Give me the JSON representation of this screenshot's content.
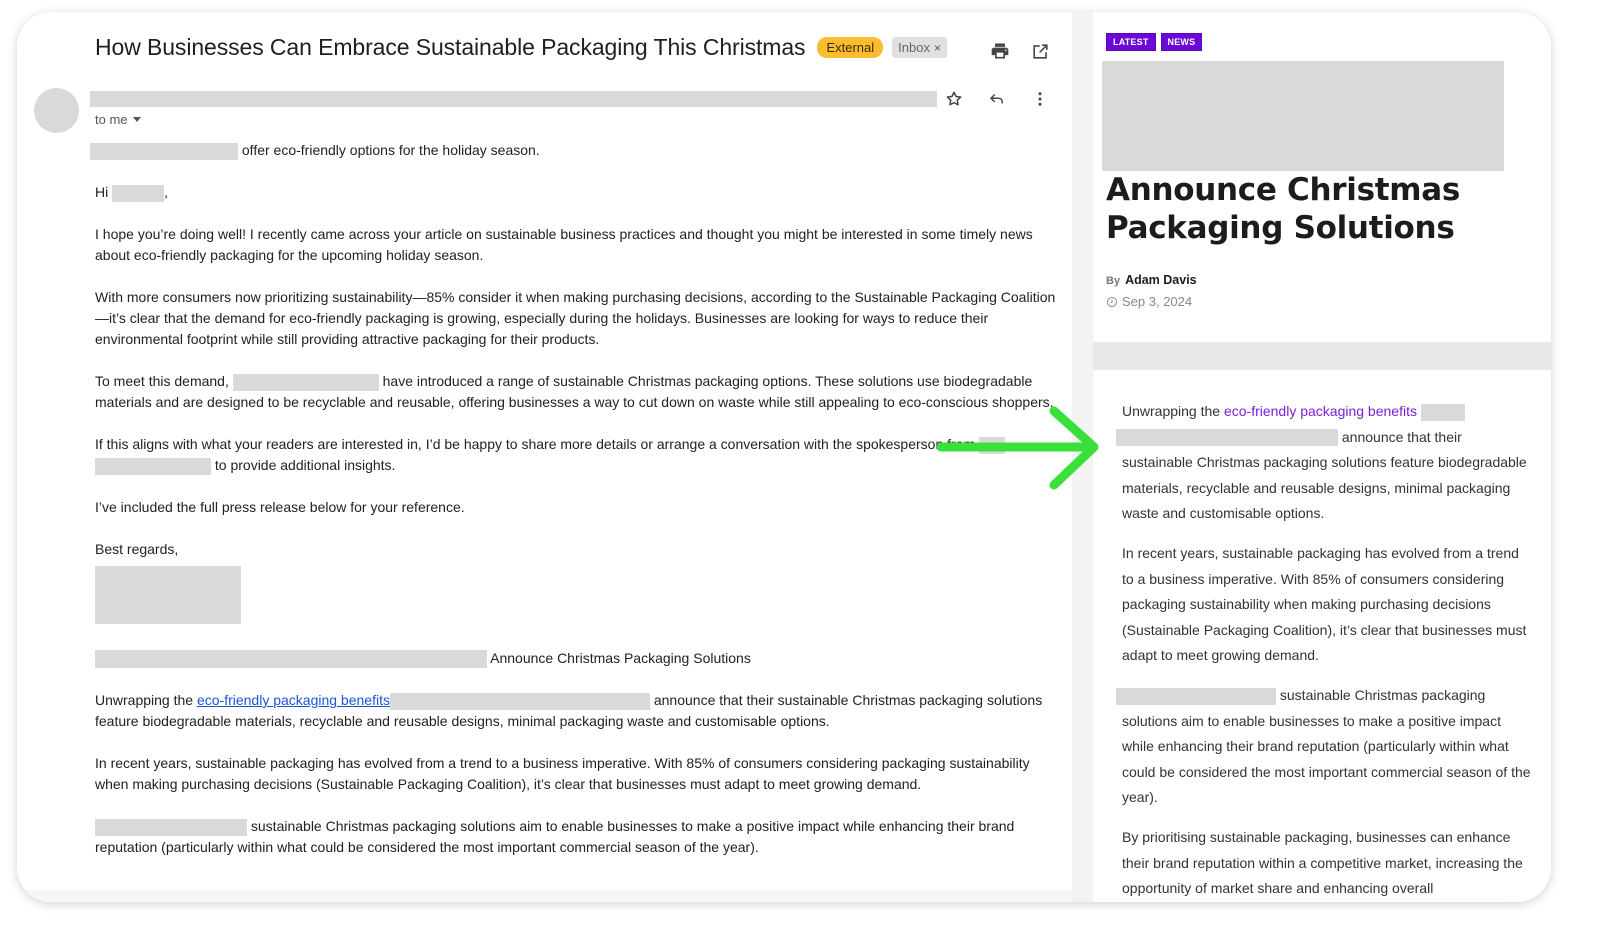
{
  "email": {
    "subject": "How Businesses Can Embrace Sustainable Packaging This Christmas",
    "labels": {
      "external": "External",
      "inbox": "Inbox",
      "inbox_remove": "×"
    },
    "toolbar_icons": [
      "print-icon",
      "open-in-new-window-icon"
    ],
    "message_icons": [
      "star-icon",
      "reply-icon",
      "more-vert-icon"
    ],
    "recipient": "to me",
    "preheader_suffix": "offer eco-friendly options for the holiday season.",
    "greeting_prefix": "Hi",
    "greeting_suffix": ",",
    "paragraphs": {
      "p1": "I hope you’re doing well! I recently came across your article on sustainable business practices and thought you might be interested in some timely news about eco-friendly packaging for the upcoming holiday season.",
      "p2": "With more consumers now prioritizing sustainability—85% consider it when making purchasing decisions, according to the Sustainable Packaging Coalition—it’s clear that the demand for eco-friendly packaging is growing, especially during the holidays. Businesses are looking for ways to reduce their environmental footprint while still providing attractive packaging for their products.",
      "p3_prefix": "To meet this demand,",
      "p3_suffix": "have introduced a range of sustainable Christmas packaging options. These solutions use biodegradable materials and are designed to be recyclable and reusable, offering businesses a way to cut down on waste while still appealing to eco-conscious shoppers.",
      "p4_prefix": "If this aligns with what your readers are interested in, I’d be happy to share more details or arrange a conversation with the spokesperson from",
      "p4_suffix": "to provide additional insights.",
      "p5": "I’ve included the full press release below for your reference.",
      "signoff": "Best regards,"
    },
    "press_release": {
      "headline_suffix": "Announce Christmas Packaging Solutions",
      "pr1_prefix": "Unwrapping the",
      "pr1_link": "eco-friendly packaging benefits",
      "pr1_suffix": "announce that their sustainable Christmas packaging solutions feature biodegradable materials, recyclable and reusable designs, minimal packaging waste and customisable options.",
      "pr2": "In recent years, sustainable packaging has evolved from a trend to a business imperative. With 85% of consumers considering packaging sustainability when making purchasing decisions (Sustainable Packaging Coalition), it’s clear that businesses must adapt to meet growing demand.",
      "pr3_suffix": "sustainable Christmas packaging solutions aim to enable businesses to make a positive impact while enhancing their brand reputation (particularly within what could be considered the most important commercial season of the year)."
    }
  },
  "article": {
    "tags": [
      "LATEST",
      "NEWS"
    ],
    "title": "Announce Christmas Packaging Solutions",
    "byline_prefix": "By",
    "author": "Adam Davis",
    "date": "Sep 3, 2024",
    "body": {
      "a1_prefix": "Unwrapping the",
      "a1_link": "eco-friendly packaging benefits",
      "a1_suffix": "announce that their sustainable Christmas packaging solutions feature biodegradable materials, recyclable and reusable designs, minimal packaging waste and customisable options.",
      "a2": "In recent years, sustainable packaging has evolved from a trend to a business imperative. With 85% of consumers considering packaging sustainability when making purchasing decisions (Sustainable Packaging Coalition), it’s clear that businesses must adapt to meet growing demand.",
      "a3_suffix": "sustainable Christmas packaging solutions aim to enable businesses to make a positive impact while enhancing their brand reputation (particularly within what could be considered the most important commercial season of the year).",
      "a4": "By prioritising sustainable packaging, businesses can enhance their brand reputation within a competitive market, increasing the opportunity of market share and enhancing overall"
    }
  },
  "colors": {
    "external_badge": "#fbbc2f",
    "tag_purple": "#6b0ad6",
    "email_link": "#1a56d6",
    "article_link": "#7b1fd6",
    "arrow_green": "#3ae03a",
    "redaction": "#d9d9d9"
  }
}
